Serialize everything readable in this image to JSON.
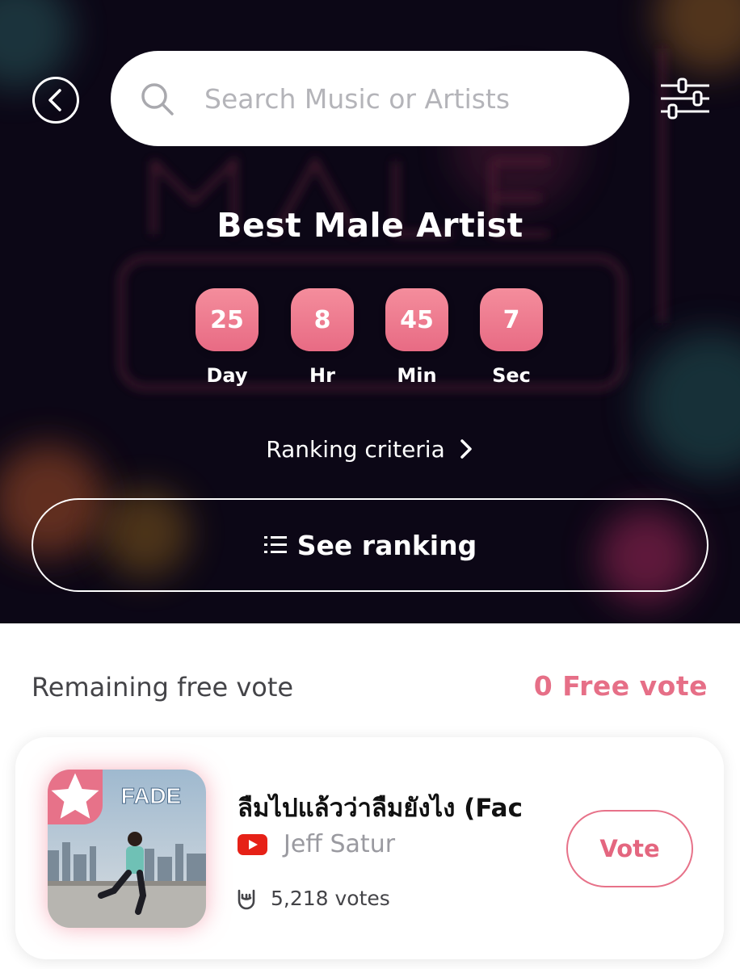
{
  "header": {
    "search_placeholder": "Search Music or Artists"
  },
  "category": {
    "title": "Best Male Artist"
  },
  "countdown": [
    {
      "value": "25",
      "label": "Day"
    },
    {
      "value": "8",
      "label": "Hr"
    },
    {
      "value": "45",
      "label": "Min"
    },
    {
      "value": "7",
      "label": "Sec"
    }
  ],
  "ranking_criteria_label": "Ranking criteria",
  "see_ranking_label": "See ranking",
  "free_vote": {
    "label": "Remaining free vote",
    "value": "0 Free vote"
  },
  "candidate": {
    "song_title": "ลืมไปแล้วว่าลืมยังไง (Fac",
    "artist": "Jeff Satur",
    "votes": "5,218 votes",
    "vote_label": "Vote",
    "source_icon": "youtube-icon",
    "cover_text": "FADE"
  },
  "colors": {
    "accent": "#e77289",
    "hero_bg": "#0c0716",
    "countdown_box": "#ee7b90"
  }
}
